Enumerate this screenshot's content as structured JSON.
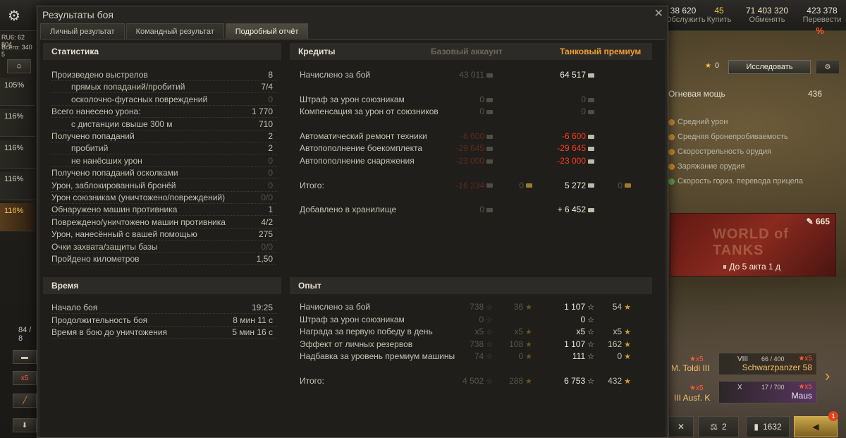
{
  "header": {
    "credits_action": "Обслужить",
    "credits_value": "38 620",
    "gold_value": "45",
    "gold_action": "Купить",
    "free_xp_value": "71 403 320",
    "free_xp_action": "Обменять",
    "bonds_value": "423 378",
    "bonds_action": "Перевести",
    "bonds_badge": "%"
  },
  "left": {
    "ru_label": "RU6: 62 804",
    "all_label": "Всего: 340 5",
    "percents": [
      "105%",
      "116%",
      "116%",
      "116%",
      "116%"
    ],
    "progress": "84 / 8",
    "x5": "x5"
  },
  "right_panel": {
    "stars_count": "0",
    "research_label": "Исследовать",
    "firepower_label": "Огневая мощь",
    "firepower_value": "436",
    "skills": [
      "Средний урон",
      "Средняя бронепробиваемость",
      "Скорострельность орудия",
      "Заряжание орудия",
      "Скорость гориз. перевода прицела"
    ],
    "banner_points": "665",
    "banner_logo": "WORLD of TANKS",
    "banner_timer": "До 5 акта 1 д",
    "tanks": [
      {
        "partial": "M. Toldi III",
        "x5": "★x5"
      },
      {
        "tier": "VIII",
        "xp": "66 / 400",
        "name": "Schwarzpanzer 58",
        "x5": "★x5"
      },
      {
        "partial": "III Ausf. K",
        "x5": "★x5"
      },
      {
        "tier": "X",
        "xp": "17 / 700",
        "name": "Maus",
        "x5": "★x5"
      }
    ],
    "bottom": {
      "crew": "2",
      "stats": "1632",
      "notif": "1"
    }
  },
  "dialog": {
    "title": "Результаты боя",
    "tabs": [
      "Личный результат",
      "Командный результат",
      "Подробный отчёт"
    ],
    "active_tab": 2,
    "stats": {
      "heading": "Статистика",
      "rows": [
        {
          "label": "Произведено выстрелов",
          "value": "8",
          "indent": 0,
          "dim": false
        },
        {
          "label": "прямых попаданий/пробитий",
          "value": "7/4",
          "indent": 1,
          "dim": false
        },
        {
          "label": "осколочно-фугасных повреждений",
          "value": "0",
          "indent": 1,
          "dim": true
        },
        {
          "label": "Всего нанесено урона:",
          "value": "1 770",
          "indent": 0,
          "dim": false
        },
        {
          "label": "с дистанции свыше 300 м",
          "value": "710",
          "indent": 1,
          "dim": false
        },
        {
          "label": "Получено попаданий",
          "value": "2",
          "indent": 0,
          "dim": false
        },
        {
          "label": "пробитий",
          "value": "2",
          "indent": 1,
          "dim": false
        },
        {
          "label": "не нанёсших урон",
          "value": "0",
          "indent": 1,
          "dim": true
        },
        {
          "label": "Получено попаданий осколками",
          "value": "0",
          "indent": 0,
          "dim": true
        },
        {
          "label": "Урон, заблокированный бронёй",
          "value": "0",
          "indent": 0,
          "dim": true
        },
        {
          "label": "Урон союзникам (уничтожено/повреждений)",
          "value": "0/0",
          "indent": 0,
          "dim": true
        },
        {
          "label": "Обнаружено машин противника",
          "value": "1",
          "indent": 0,
          "dim": false
        },
        {
          "label": "Повреждено/уничтожено машин противника",
          "value": "4/2",
          "indent": 0,
          "dim": false
        },
        {
          "label": "Урон, нанесённый с вашей помощью",
          "value": "275",
          "indent": 0,
          "dim": false
        },
        {
          "label": "Очки захвата/защиты базы",
          "value": "0/0",
          "indent": 0,
          "dim": true
        },
        {
          "label": "Пройдено километров",
          "value": "1,50",
          "indent": 0,
          "dim": false
        }
      ]
    },
    "time": {
      "heading": "Время",
      "rows": [
        {
          "label": "Начало боя",
          "value": "19:25"
        },
        {
          "label": "Продолжительность боя",
          "value": "8 мин 11 с"
        },
        {
          "label": "Время в бою до уничтожения",
          "value": "5 мин 16 с"
        }
      ]
    },
    "credits": {
      "heading": "Кредиты",
      "col_base": "Базовый аккаунт",
      "col_premium": "Танковый премиум",
      "rows": [
        {
          "label": "Начислено за бой",
          "base": "43 011",
          "base_style": "dim",
          "base_gold": "",
          "prem": "64 517",
          "prem_style": "bright",
          "prem_gold": ""
        },
        {
          "label": "",
          "base": "",
          "base_style": "dim",
          "base_gold": "",
          "prem": "",
          "prem_style": "",
          "prem_gold": ""
        },
        {
          "label": "Штраф за урон союзникам",
          "base": "0",
          "base_style": "dim",
          "base_gold": "",
          "prem": "0",
          "prem_style": "dim",
          "prem_gold": ""
        },
        {
          "label": "Компенсация за урон от союзников",
          "base": "0",
          "base_style": "dim",
          "base_gold": "",
          "prem": "0",
          "prem_style": "dim",
          "prem_gold": ""
        },
        {
          "label": "",
          "base": "",
          "base_style": "dim",
          "base_gold": "",
          "prem": "",
          "prem_style": "",
          "prem_gold": ""
        },
        {
          "label": "Автоматический ремонт техники",
          "base": "-6 600",
          "base_style": "redd",
          "base_gold": "",
          "prem": "-6 600",
          "prem_style": "red",
          "prem_gold": ""
        },
        {
          "label": "Автопополнение боекомплекта",
          "base": "-29 645",
          "base_style": "redd",
          "base_gold": "",
          "prem": "-29 645",
          "prem_style": "red",
          "prem_gold": ""
        },
        {
          "label": "Автопополнение снаряжения",
          "base": "-23 000",
          "base_style": "redd",
          "base_gold": "",
          "prem": "-23 000",
          "prem_style": "red",
          "prem_gold": ""
        },
        {
          "label": "",
          "base": "",
          "base_style": "dim",
          "base_gold": "",
          "prem": "",
          "prem_style": "",
          "prem_gold": ""
        },
        {
          "label": "Итого:",
          "base": "-16 234",
          "base_style": "redd",
          "base_gold": "0",
          "prem": "5 272",
          "prem_style": "bright",
          "prem_gold": "0"
        },
        {
          "label": "",
          "base": "",
          "base_style": "dim",
          "base_gold": "",
          "prem": "",
          "prem_style": "",
          "prem_gold": ""
        },
        {
          "label": "Добавлено в хранилище",
          "base": "0",
          "base_style": "dim",
          "base_gold": "",
          "prem": "+ 6 452",
          "prem_style": "bright",
          "prem_gold": ""
        }
      ]
    },
    "experience": {
      "heading": "Опыт",
      "rows": [
        {
          "label": "Начислено за бой",
          "b1": "738",
          "b2": "36",
          "p1": "1 107",
          "p2": "54"
        },
        {
          "label": "Штраф за урон союзникам",
          "b1": "0",
          "b2": "",
          "p1": "0",
          "p2": ""
        },
        {
          "label": "Награда за первую победу в день",
          "b1": "x5",
          "b2": "x5",
          "p1": "x5",
          "p2": "x5"
        },
        {
          "label": "Эффект от личных резервов",
          "b1": "738",
          "b2": "108",
          "p1": "1 107",
          "p2": "162"
        },
        {
          "label": "Надбавка за уровень премиум машины",
          "b1": "74",
          "b2": "0",
          "p1": "111",
          "p2": "0"
        },
        {
          "label": "",
          "b1": "",
          "b2": "",
          "p1": "",
          "p2": ""
        },
        {
          "label": "Итого:",
          "b1": "4 502",
          "b2": "288",
          "p1": "6 753",
          "p2": "432"
        }
      ]
    }
  }
}
